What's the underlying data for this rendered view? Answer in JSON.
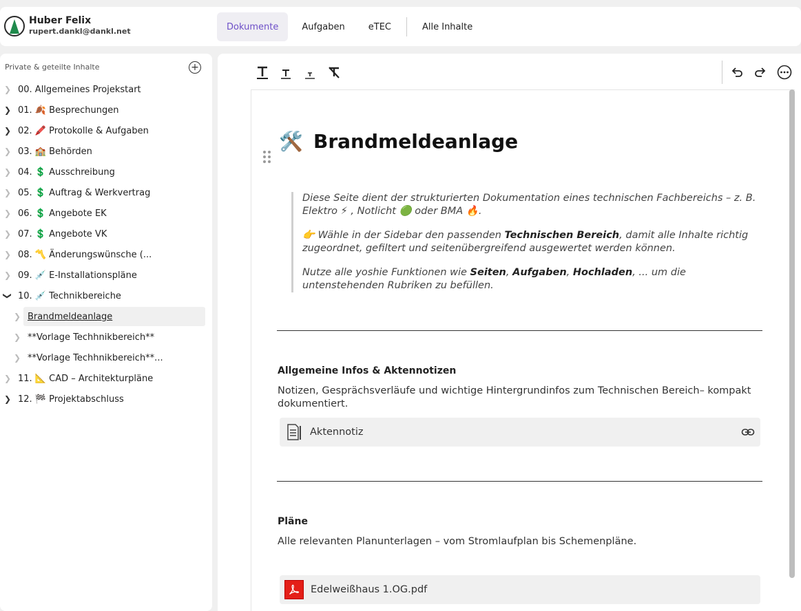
{
  "user": {
    "name": "Huber Felix",
    "email": "rupert.dankl@dankl.net"
  },
  "tabs": [
    {
      "label": "Dokumente",
      "active": true
    },
    {
      "label": "Aufgaben",
      "active": false
    },
    {
      "label": "eTEC",
      "active": false
    },
    {
      "label": "Alle Inhalte",
      "active": false
    }
  ],
  "sidebar": {
    "heading": "Private & geteilte Inhalte",
    "items": [
      {
        "label": "00. Allgemeines Projekstart",
        "expandable": false
      },
      {
        "label": "01. 🍂 Besprechungen",
        "expandable": true
      },
      {
        "label": "02. 🖍️ Protokolle & Aufgaben",
        "expandable": true
      },
      {
        "label": "03. 🏫 Behörden",
        "expandable": false
      },
      {
        "label": "04. 💲 Ausschreibung",
        "expandable": false
      },
      {
        "label": "05. 💲 Auftrag & Werkvertrag",
        "expandable": false
      },
      {
        "label": "06. 💲 Angebote EK",
        "expandable": false
      },
      {
        "label": "07. 💲 Angebote VK",
        "expandable": false
      },
      {
        "label": "08. 〽️ Änderungswünsche (...",
        "expandable": false
      },
      {
        "label": "09. 💉 E-Installationspläne",
        "expandable": false
      },
      {
        "label": "10. 💉 Technikbereiche",
        "expandable": true,
        "expanded": true
      },
      {
        "label": "Brandmeldeanlage",
        "child": true,
        "selected": true
      },
      {
        "label": "**Vorlage Techhnikbereich**",
        "child": true
      },
      {
        "label": "**Vorlage Techhnikbereich**...",
        "child": true
      },
      {
        "label": "11. 📐 CAD – Architekturpläne",
        "expandable": false
      },
      {
        "label": "12. 🏁 Projektabschluss",
        "expandable": true
      }
    ]
  },
  "icons": {
    "add": "plus-circle-icon",
    "undo": "undo-icon",
    "redo": "redo-icon",
    "more": "more-icon",
    "text_large": "text-large-icon",
    "text_medium": "text-medium-icon",
    "text_small": "text-small-icon",
    "clear_format": "clear-format-icon"
  },
  "page": {
    "title_icon": "🛠️",
    "title": "Brandmeldeanlage",
    "quote": {
      "p1": "Diese Seite dient der strukturierten Dokumentation eines technischen Fachbereichs – z. B. Elektro ⚡ , Notlicht 🟢 oder BMA 🔥.",
      "p2_pre": "👉 Wähle in der Sidebar den passenden ",
      "p2_bold": "Technischen Bereich",
      "p2_post": ", damit alle Inhalte richtig zugeordnet, gefiltert und seitenübergreifend ausgewertet werden können.",
      "p3_pre": "Nutze alle yoshie Funktionen wie ",
      "p3_b1": "Seiten",
      "p3_sep1": ", ",
      "p3_b2": "Aufgaben",
      "p3_sep2": ", ",
      "p3_b3": "Hochladen",
      "p3_post": ", ... um die untenstehenden Rubriken zu befüllen."
    },
    "sections": [
      {
        "heading": "Allgemeine Infos & Aktennotizen",
        "text": "Notizen, Gesprächsverläufe und wichtige Hintergrundinfos zum Technischen Bereich– kompakt dokumentiert.",
        "embed": "Aktennotiz"
      },
      {
        "heading": "Pläne",
        "text": "Alle relevanten Planunterlagen – vom Stromlaufplan bis Schemenpläne.",
        "embed": "Edelweißhaus 1.OG.pdf"
      }
    ]
  }
}
